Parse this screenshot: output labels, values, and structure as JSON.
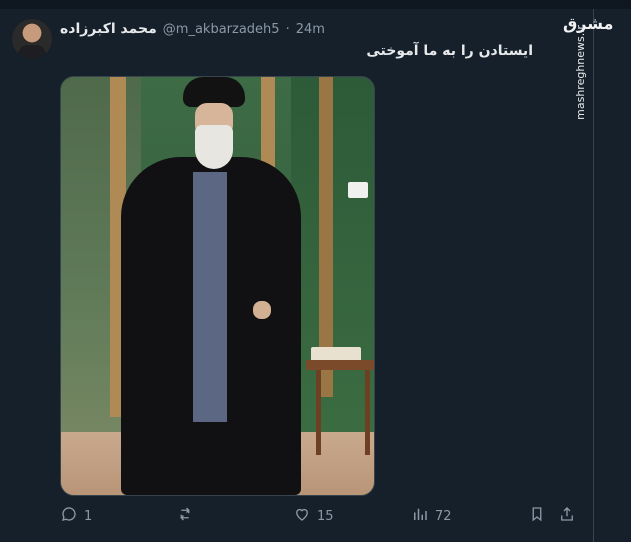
{
  "tweet": {
    "author_name": "محمد اکبرزاده",
    "handle": "@m_akbarzadeh5",
    "separator": "·",
    "time": "24m",
    "text": "ایستادن را به ما آموختی"
  },
  "watermark": {
    "logo_text": "مشرق",
    "url": "mashreghnews.ir"
  },
  "actions": {
    "reply_count": "1",
    "retweet_count": "",
    "like_count": "15",
    "view_count": "72"
  },
  "icons": {
    "reply": "reply-icon",
    "retweet": "retweet-icon",
    "like": "heart-icon",
    "views": "views-icon",
    "bookmark": "bookmark-icon",
    "share": "share-icon"
  }
}
